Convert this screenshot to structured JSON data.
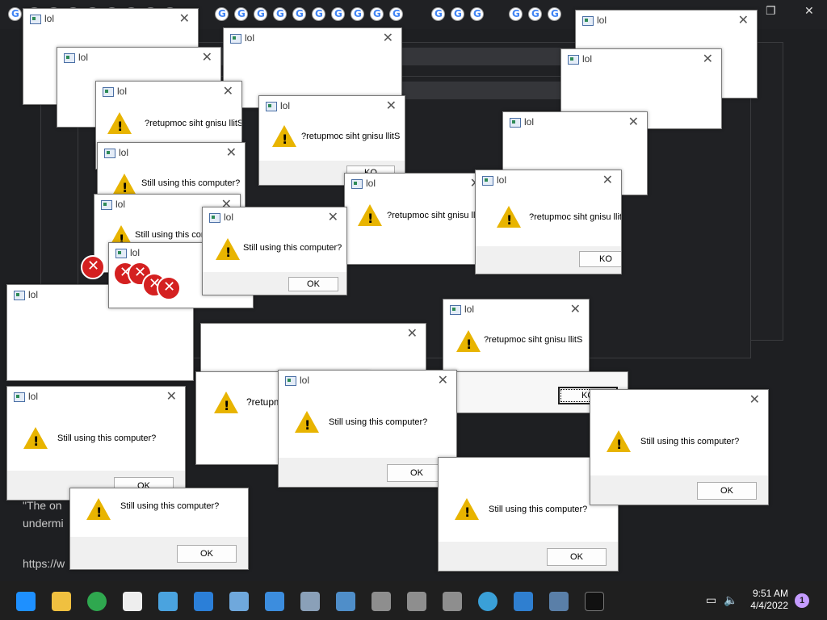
{
  "dialog_title": "lol",
  "message": "Still using this computer?",
  "message_reversed": "?retupmoc siht gnisu llitS",
  "message_partial": "?retupm",
  "message_partial2": "Still using this comp",
  "ok_label": "OK",
  "ok_label_mirrored": "KO",
  "close_glyph": "✕",
  "background_text": {
    "line1": "\"The on",
    "line2": "undermi",
    "line3": "https://w"
  },
  "taskbar": {
    "time": "9:51 AM",
    "date": "4/4/2022",
    "notification_count": "1",
    "apps": [
      "start-icon",
      "file-explorer-icon",
      "chrome-icon",
      "7zip-icon",
      "notepad-icon",
      "photos-icon",
      "paint-icon",
      "terminal-window-icon",
      "calculator-icon",
      "control-panel-icon",
      "network-icon",
      "network-icon-2",
      "network-icon-3",
      "globe-icon",
      "puzzle-icon",
      "performance-monitor-icon",
      "command-prompt-icon"
    ]
  },
  "colors": {
    "warning": "#e8b400",
    "error": "#d42020",
    "accent": "#0078d4"
  }
}
